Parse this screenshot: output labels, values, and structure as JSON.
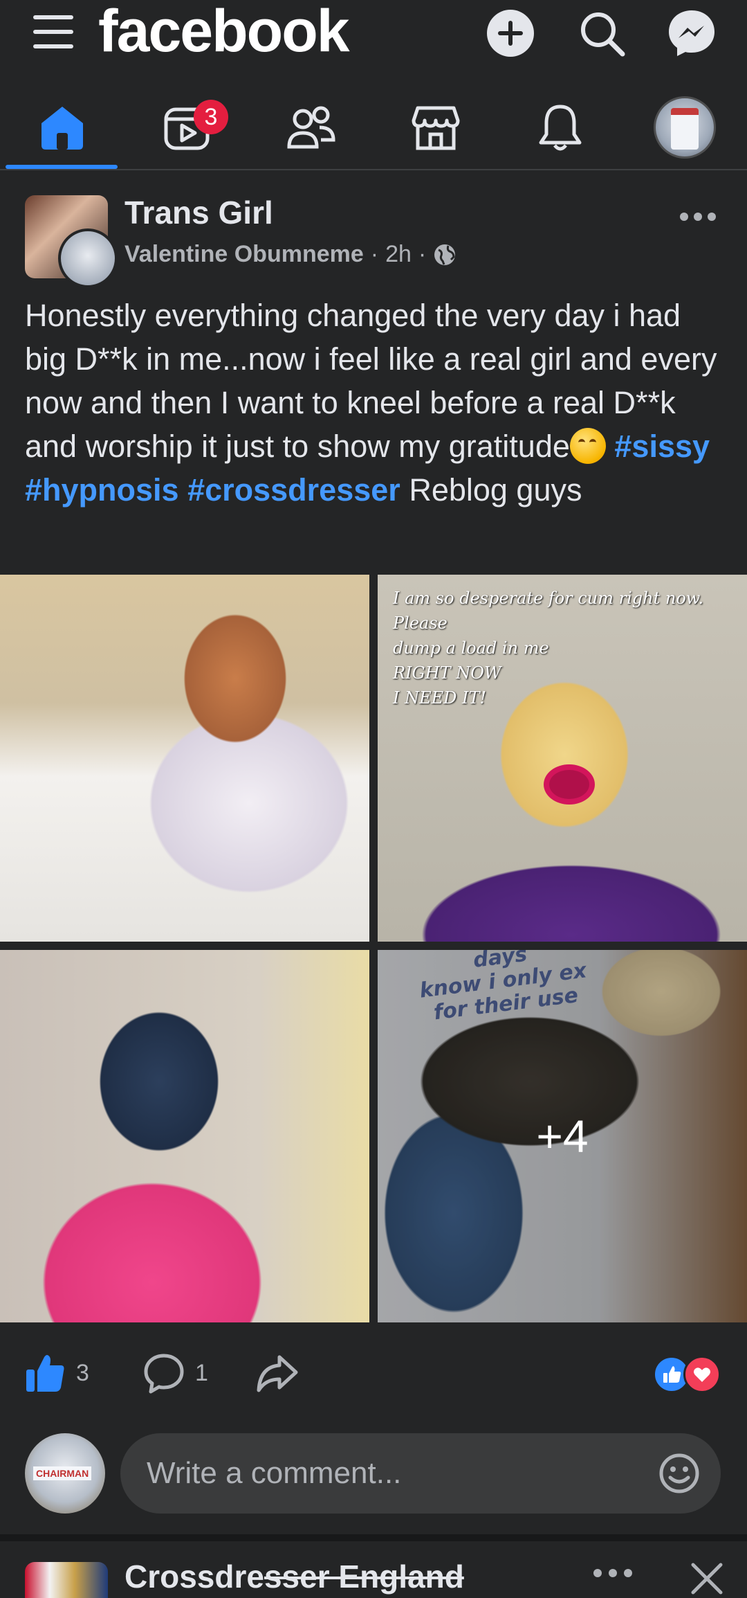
{
  "header": {
    "brand": "facebook",
    "icons": [
      "menu-icon",
      "create-plus-icon",
      "search-icon",
      "messenger-icon"
    ]
  },
  "nav": {
    "tabs": [
      {
        "name": "home",
        "icon": "home-icon",
        "active": true
      },
      {
        "name": "video",
        "icon": "video-icon",
        "badge": "3"
      },
      {
        "name": "friends",
        "icon": "friends-icon"
      },
      {
        "name": "marketplace",
        "icon": "marketplace-icon"
      },
      {
        "name": "notifications",
        "icon": "bell-icon"
      },
      {
        "name": "profile",
        "icon": "profile-avatar"
      }
    ],
    "video_badge": "3",
    "accent": "#2d88ff"
  },
  "post": {
    "group_name": "Trans Girl",
    "poster": "Valentine Obumneme",
    "time": "2h",
    "sep": "·",
    "text_main": "Honestly everything changed the very day i had big D**k in me...now i feel like a real girl and every now and then I want to kneel before a real D**k and worship it just to show my gratitude",
    "tags": [
      "#sissy",
      "#hypnosis",
      "#crossdresser"
    ],
    "text_tail": "Reblog guys",
    "photos": {
      "photo2_caption": "I am so desperate for cum right now.  Please\ndump a load in me\nRIGHT NOW\nI NEED IT!",
      "photo4_caption": "days\nknow i only ex\nfor their use",
      "more_count": "+4"
    },
    "reactions": {
      "likes": "3",
      "comments": "1",
      "like_color": "#2d88ff",
      "love_color": "#f33e58"
    },
    "comment_placeholder": "Write a comment..."
  },
  "next_post": {
    "title_plain": "Crossdre",
    "title_struck": "sser England"
  }
}
